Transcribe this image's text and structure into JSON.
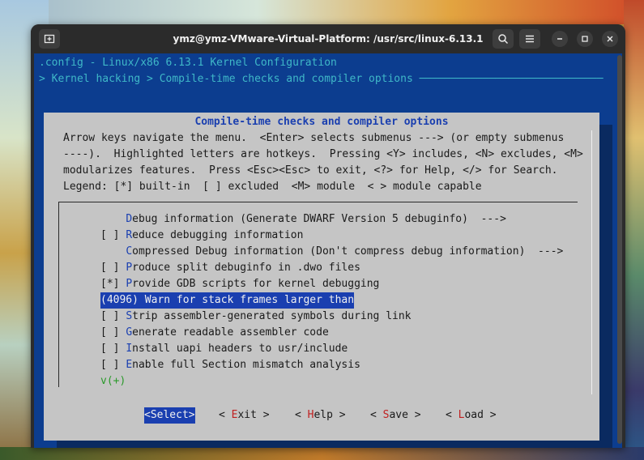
{
  "window": {
    "title": "ymz@ymz-VMware-Virtual-Platform: /usr/src/linux-6.13.1"
  },
  "header": {
    "config_line": ".config - Linux/x86 6.13.1 Kernel Configuration",
    "breadcrumb": "> Kernel hacking > Compile-time checks and compiler options ─────────────────────────────"
  },
  "dialog": {
    "title": "Compile-time checks and compiler options",
    "help_lines": [
      "Arrow keys navigate the menu.  <Enter> selects submenus ---> (or empty submenus",
      "----).  Highlighted letters are hotkeys.  Pressing <Y> includes, <N> excludes, <M>",
      "modularizes features.  Press <Esc><Esc> to exit, <?> for Help, </> for Search.",
      "Legend: [*] built-in  [ ] excluded  <M> module  < > module capable"
    ],
    "items": [
      {
        "prefix": "    ",
        "hot": "D",
        "rest": "ebug information (Generate DWARF Version 5 debuginfo)  --->"
      },
      {
        "prefix": "[ ] ",
        "hot": "R",
        "rest": "educe debugging information"
      },
      {
        "prefix": "    ",
        "hot": "C",
        "rest": "ompressed Debug information (Don't compress debug information)  --->"
      },
      {
        "prefix": "[ ] ",
        "hot": "P",
        "rest": "roduce split debuginfo in .dwo files"
      },
      {
        "prefix": "[*] ",
        "hot": "P",
        "rest": "rovide GDB scripts for kernel debugging"
      },
      {
        "prefix": "(4096) ",
        "hot": "W",
        "rest": "arn for stack frames larger than"
      },
      {
        "prefix": "[ ] ",
        "hot": "S",
        "rest": "trip assembler-generated symbols during link"
      },
      {
        "prefix": "[ ] ",
        "hot": "G",
        "rest": "enerate readable assembler code"
      },
      {
        "prefix": "[ ] ",
        "hot": "I",
        "rest": "nstall uapi headers to usr/include"
      },
      {
        "prefix": "[ ] ",
        "hot": "E",
        "rest": "nable full Section mismatch analysis"
      }
    ],
    "more_indicator": "v(+)",
    "buttons": {
      "select": "<Select>",
      "exit_pre": "< ",
      "exit_hot": "E",
      "exit_rest": "xit >",
      "help_pre": "< ",
      "help_hot": "H",
      "help_rest": "elp >",
      "save_pre": "< ",
      "save_hot": "S",
      "save_rest": "ave >",
      "load_pre": "< ",
      "load_hot": "L",
      "load_rest": "oad >"
    }
  },
  "colors": {
    "terminal_bg": "#0c3d8f",
    "dialog_bg": "#c5c5c5",
    "highlight": "#1a3fb0",
    "hotkey_red": "#c02020"
  }
}
